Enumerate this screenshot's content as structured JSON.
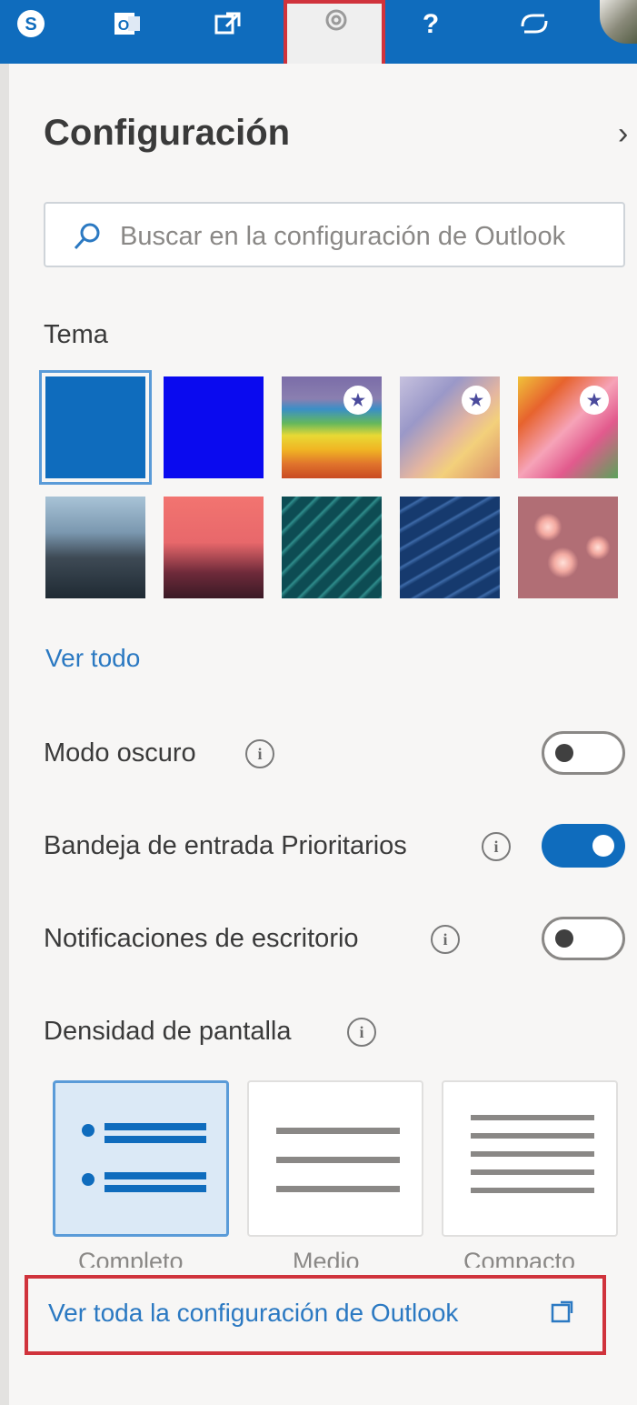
{
  "topbar": {
    "icons": [
      "skype-icon",
      "office-icon",
      "share-icon",
      "gear-icon",
      "help-icon",
      "feedback-icon",
      "avatar"
    ],
    "highlight_color": "#d0333c",
    "bar_color": "#0f6cbd"
  },
  "panel": {
    "title": "Configuración",
    "search": {
      "placeholder": "Buscar en la configuración de Outlook"
    },
    "theme": {
      "label": "Tema",
      "tiles": [
        {
          "name": "blue-solid",
          "selected": true
        },
        {
          "name": "bright-blue"
        },
        {
          "name": "stripes-rainbow",
          "premium": true
        },
        {
          "name": "abstract-pastel",
          "premium": true
        },
        {
          "name": "colorful-art",
          "premium": true
        },
        {
          "name": "mountain"
        },
        {
          "name": "palm-sunset"
        },
        {
          "name": "circuit"
        },
        {
          "name": "lines-blue"
        },
        {
          "name": "bokeh-pink"
        }
      ],
      "see_all": "Ver todo"
    },
    "settings": [
      {
        "label": "Modo oscuro",
        "state": "off"
      },
      {
        "label": "Bandeja de entrada Prioritarios",
        "state": "on"
      },
      {
        "label": "Notificaciones de escritorio",
        "state": "off"
      }
    ],
    "density": {
      "label": "Densidad de pantalla",
      "options": [
        "Completo",
        "Medio",
        "Compacto"
      ],
      "selected": "Completo"
    },
    "bottom_link": "Ver toda la configuración de Outlook"
  }
}
